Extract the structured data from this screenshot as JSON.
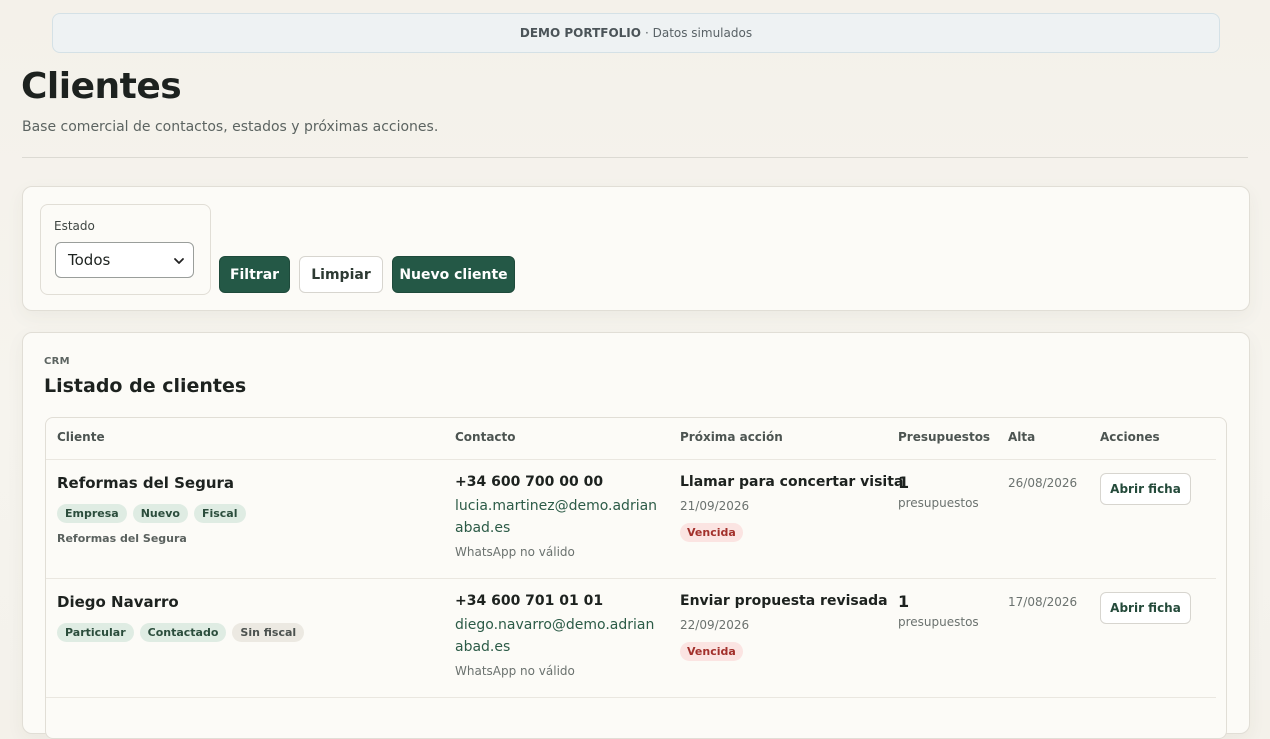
{
  "banner": {
    "bold": "DEMO PORTFOLIO",
    "rest": "· Datos simulados"
  },
  "header": {
    "title": "Clientes",
    "subtitle": "Base comercial de contactos, estados y próximas acciones."
  },
  "filters": {
    "estado_label": "Estado",
    "estado_value": "Todos",
    "filtrar_label": "Filtrar",
    "limpiar_label": "Limpiar",
    "nuevo_label": "Nuevo cliente"
  },
  "list": {
    "eyebrow": "CRM",
    "title": "Listado de clientes",
    "columns": [
      "Cliente",
      "Contacto",
      "Próxima acción",
      "Presupuestos",
      "Alta",
      "Acciones"
    ],
    "rows": [
      {
        "name": "Reformas del Segura",
        "tags": [
          {
            "label": "Empresa",
            "style": "green"
          },
          {
            "label": "Nuevo",
            "style": "green"
          },
          {
            "label": "Fiscal",
            "style": "green"
          }
        ],
        "sub": "Reformas del Segura",
        "phone": "+34 600 700 00 00",
        "email": "lucia.martinez@demo.adrianabad.es",
        "whatsapp": "WhatsApp no válido",
        "next_action": "Llamar para concertar visita",
        "next_date": "21/09/2026",
        "status": "Vencida",
        "quotes_count": "1",
        "quotes_label": "presupuestos",
        "alta": "26/08/2026",
        "action": "Abrir ficha"
      },
      {
        "name": "Diego Navarro",
        "tags": [
          {
            "label": "Particular",
            "style": "green"
          },
          {
            "label": "Contactado",
            "style": "green"
          },
          {
            "label": "Sin fiscal",
            "style": "grey"
          }
        ],
        "sub": "",
        "phone": "+34 600 701 01 01",
        "email": "diego.navarro@demo.adrianabad.es",
        "whatsapp": "WhatsApp no válido",
        "next_action": "Enviar propuesta revisada",
        "next_date": "22/09/2026",
        "status": "Vencida",
        "quotes_count": "1",
        "quotes_label": "presupuestos",
        "alta": "17/08/2026",
        "action": "Abrir ficha"
      }
    ]
  },
  "colors": {
    "primary": "#245846",
    "danger_bg": "#fbe4e2",
    "danger_text": "#a2302b",
    "tag_bg": "#dfece3"
  }
}
